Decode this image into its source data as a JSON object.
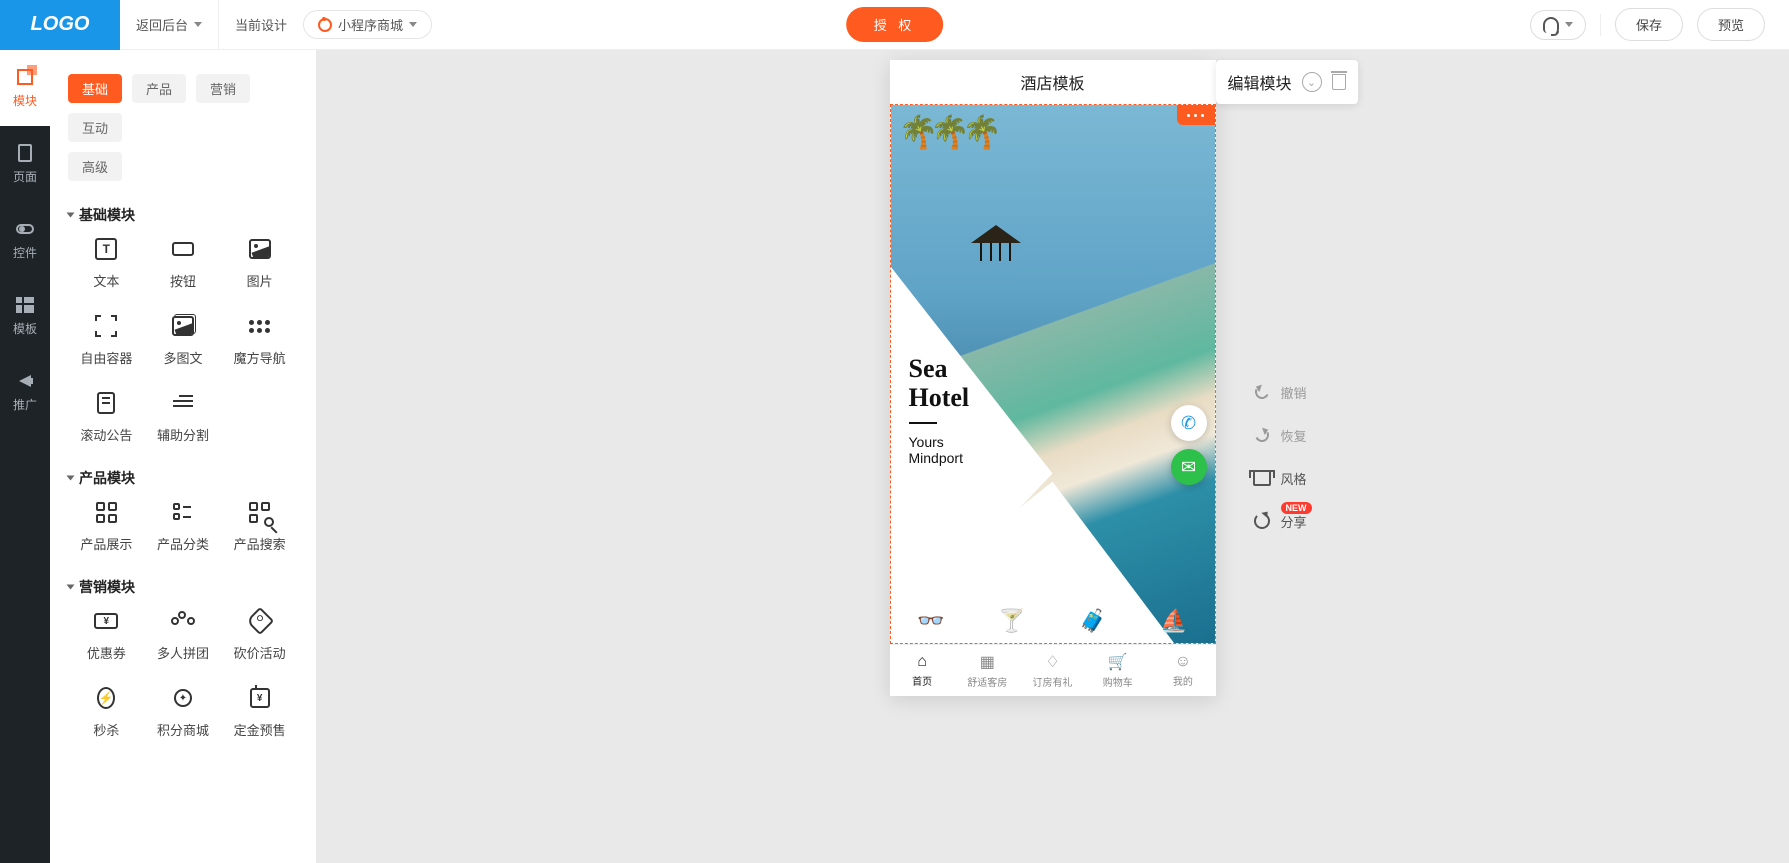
{
  "logo": "LOGO",
  "topbar": {
    "back": "返回后台",
    "current_design_label": "当前设计",
    "design_name": "小程序商城",
    "auth": "授 权",
    "save": "保存",
    "preview": "预览"
  },
  "rail": {
    "modules": "模块",
    "pages": "页面",
    "controls": "控件",
    "templates": "模板",
    "promote": "推广"
  },
  "panel": {
    "tabs": {
      "basic": "基础",
      "product": "产品",
      "marketing": "营销",
      "interactive": "互动",
      "advanced": "高级"
    },
    "sections": {
      "basic": {
        "title": "基础模块",
        "items": {
          "text": "文本",
          "button": "按钮",
          "image": "图片",
          "free_container": "自由容器",
          "multi_image": "多图文",
          "cube_nav": "魔方导航",
          "scroll_notice": "滚动公告",
          "aux_divider": "辅助分割"
        }
      },
      "product": {
        "title": "产品模块",
        "items": {
          "display": "产品展示",
          "category": "产品分类",
          "search": "产品搜索"
        }
      },
      "marketing": {
        "title": "营销模块",
        "items": {
          "coupon": "优惠券",
          "group": "多人拼团",
          "bargain": "砍价活动",
          "seckill": "秒杀",
          "points_mall": "积分商城",
          "deposit": "定金预售"
        }
      }
    }
  },
  "phone": {
    "title": "酒店模板",
    "edit_popup": "编辑模块",
    "hero": {
      "h1a": "Sea",
      "h1b": "Hotel",
      "sub1": "Yours",
      "sub2": "Mindport"
    },
    "nav": {
      "home": "首页",
      "rooms": "舒适客房",
      "booking": "订房有礼",
      "cart": "购物车",
      "mine": "我的"
    }
  },
  "rtool": {
    "undo": "撤销",
    "redo": "恢复",
    "style": "风格",
    "share": "分享",
    "badge": "NEW"
  }
}
